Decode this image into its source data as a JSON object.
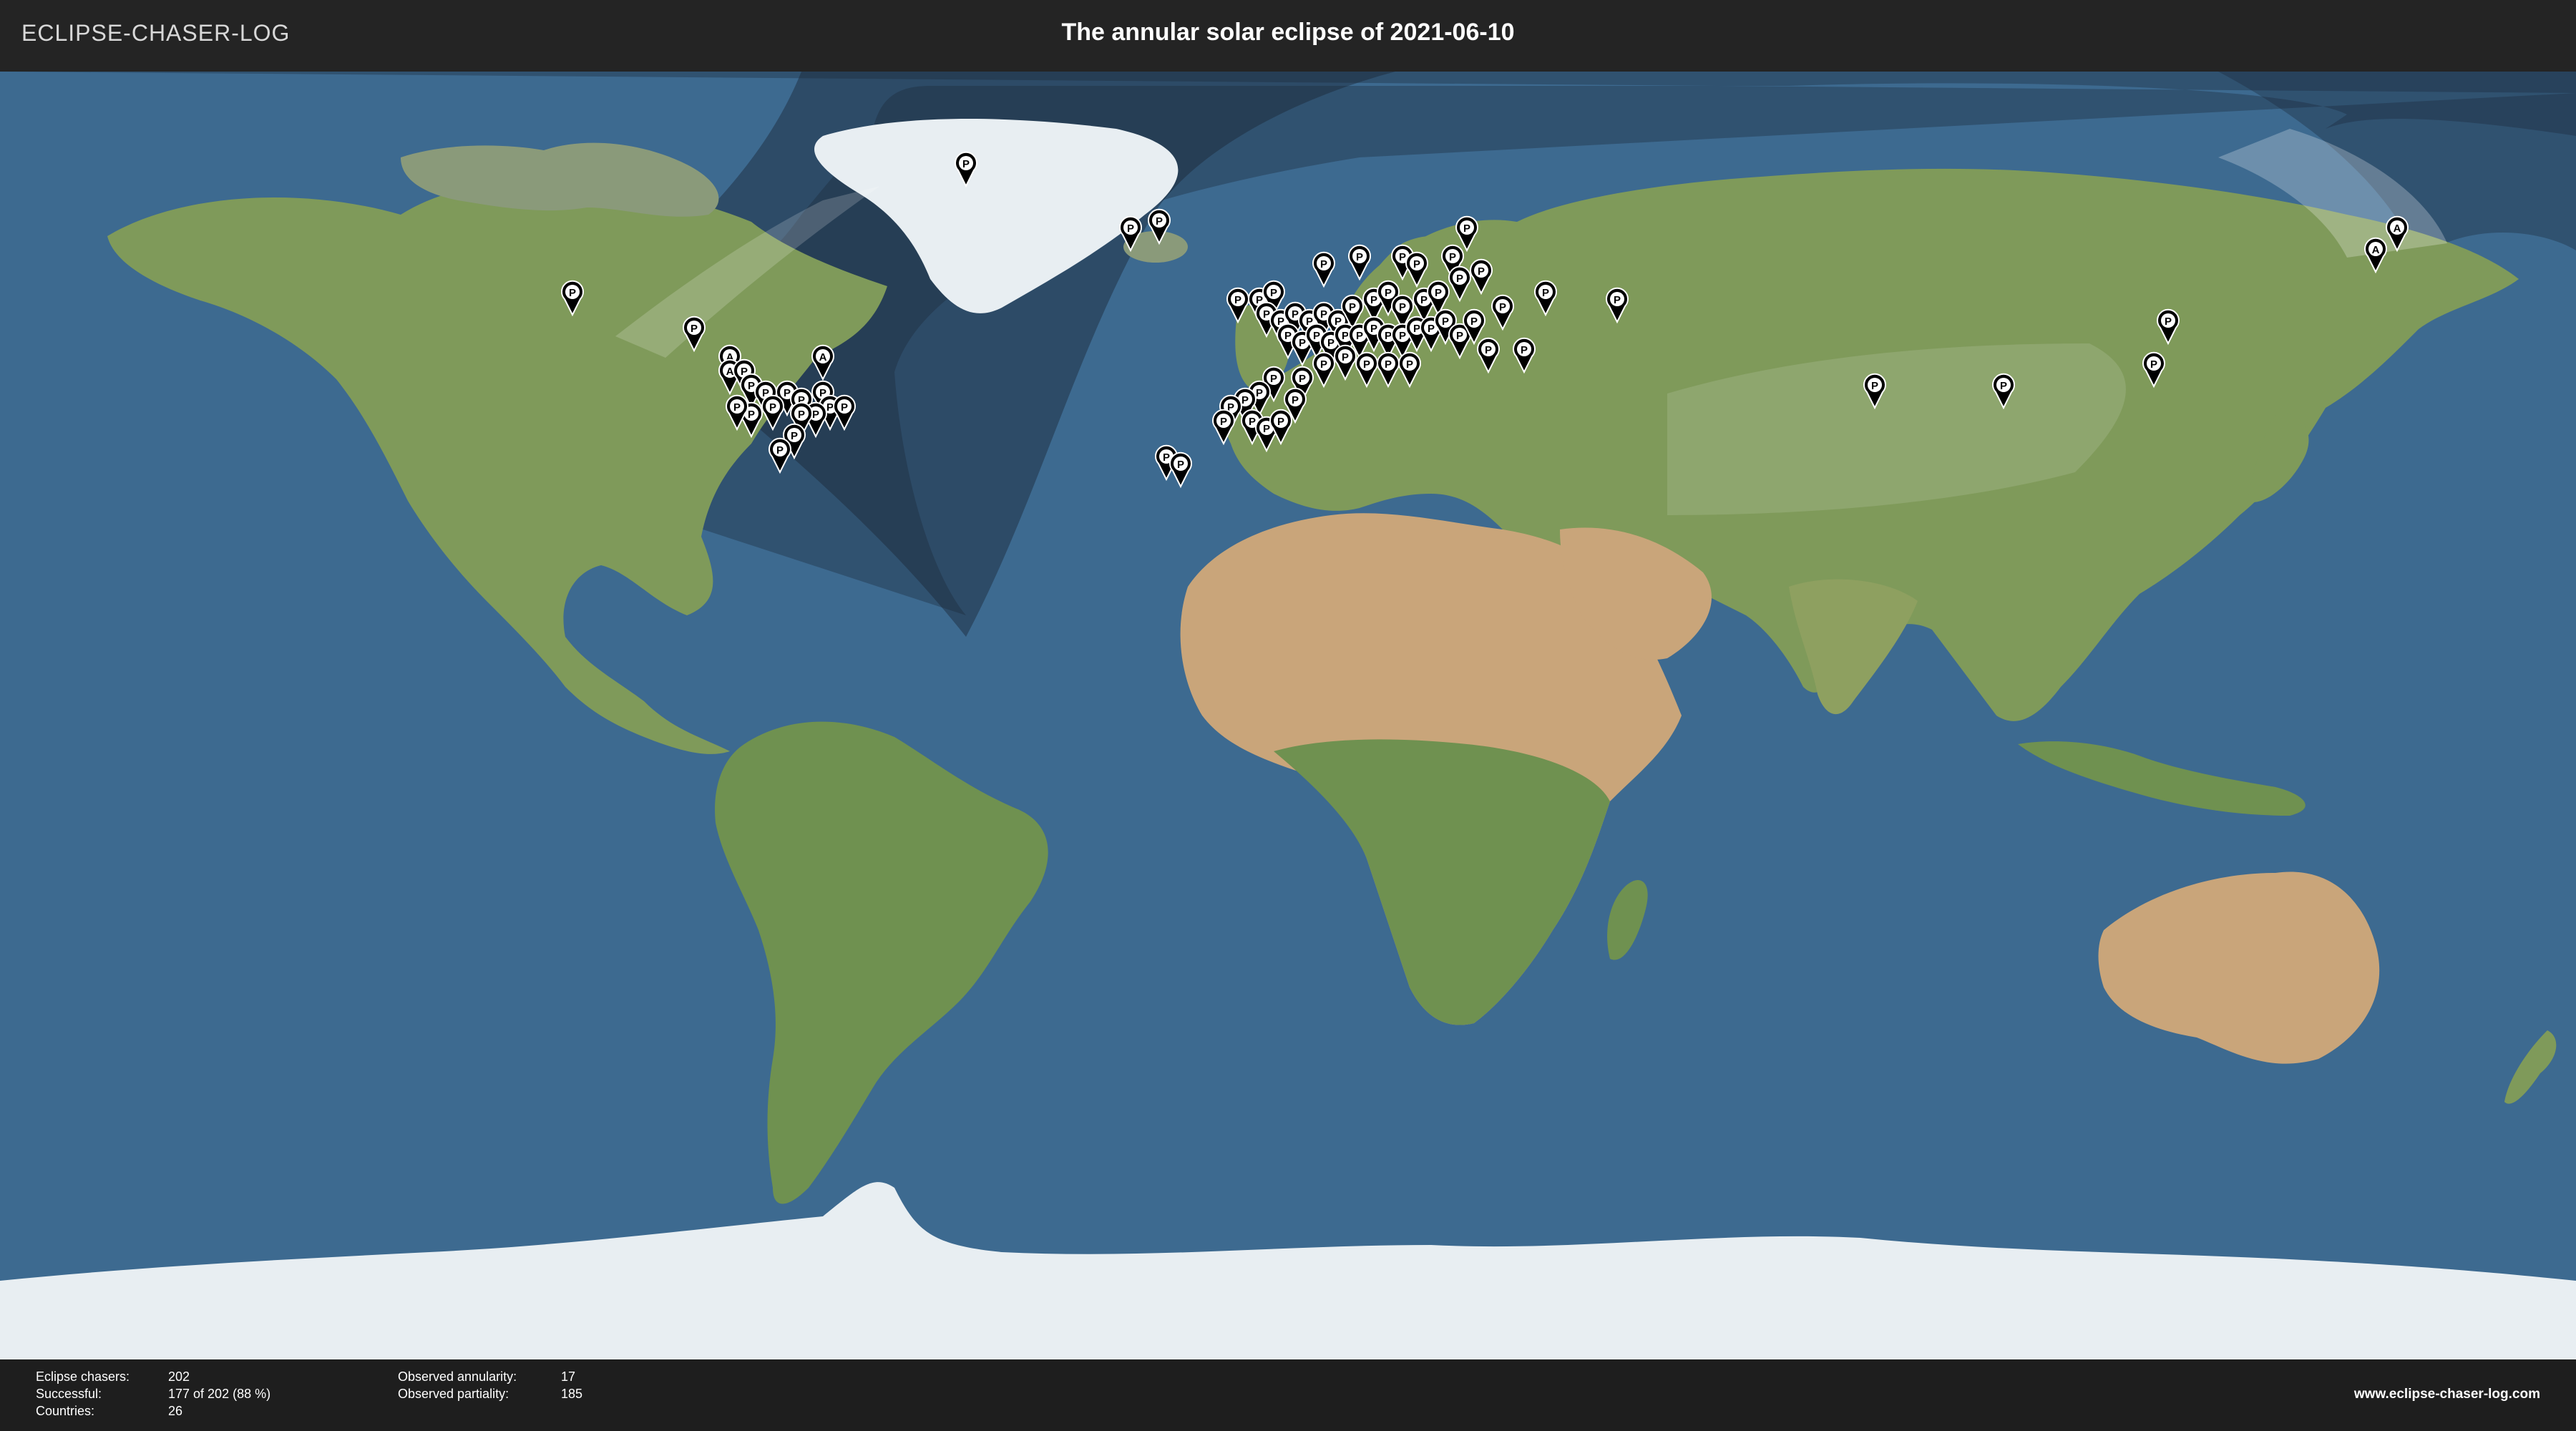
{
  "header": {
    "logo_text": "ECLIPSE-CHASER-LOG",
    "title": "The annular solar eclipse of 2021-06-10"
  },
  "map": {
    "ocean_color": "#3d6a90",
    "land_color": "#7f9a5a",
    "desert_color": "#c9a57a",
    "ice_color": "#e8eef2",
    "shadow_color": "#1a2636",
    "marker_color": "#000000",
    "marker_symbol_color": "#ffffff",
    "marker_icon": "map-pin-icon",
    "marker_types": {
      "P": "observed partiality",
      "A": "observed annularity"
    },
    "markers": [
      {
        "label": "P",
        "lon": -100,
        "lat": 56
      },
      {
        "label": "P",
        "lon": -83,
        "lat": 51
      },
      {
        "label": "A",
        "lon": -78,
        "lat": 47
      },
      {
        "label": "A",
        "lon": -65,
        "lat": 47
      },
      {
        "label": "A",
        "lon": -78,
        "lat": 45
      },
      {
        "label": "P",
        "lon": -76,
        "lat": 45
      },
      {
        "label": "P",
        "lon": -75,
        "lat": 43
      },
      {
        "label": "P",
        "lon": -73,
        "lat": 42
      },
      {
        "label": "P",
        "lon": -70,
        "lat": 42
      },
      {
        "label": "P",
        "lon": -68,
        "lat": 41
      },
      {
        "label": "P",
        "lon": -65,
        "lat": 42
      },
      {
        "label": "P",
        "lon": -64,
        "lat": 40
      },
      {
        "label": "P",
        "lon": -66,
        "lat": 39
      },
      {
        "label": "P",
        "lon": -62,
        "lat": 40
      },
      {
        "label": "P",
        "lon": -72,
        "lat": 40
      },
      {
        "label": "P",
        "lon": -75,
        "lat": 39
      },
      {
        "label": "P",
        "lon": -77,
        "lat": 40
      },
      {
        "label": "P",
        "lon": -68,
        "lat": 39
      },
      {
        "label": "P",
        "lon": -69,
        "lat": 36
      },
      {
        "label": "P",
        "lon": -71,
        "lat": 34
      },
      {
        "label": "P",
        "lon": -45,
        "lat": 74
      },
      {
        "label": "P",
        "lon": -22,
        "lat": 65
      },
      {
        "label": "P",
        "lon": -18,
        "lat": 66
      },
      {
        "label": "P",
        "lon": -17,
        "lat": 33
      },
      {
        "label": "P",
        "lon": -15,
        "lat": 32
      },
      {
        "label": "P",
        "lon": 5,
        "lat": 60
      },
      {
        "label": "P",
        "lon": 10,
        "lat": 61
      },
      {
        "label": "P",
        "lon": 16,
        "lat": 61
      },
      {
        "label": "P",
        "lon": 18,
        "lat": 60
      },
      {
        "label": "P",
        "lon": 23,
        "lat": 61
      },
      {
        "label": "P",
        "lon": 25,
        "lat": 65
      },
      {
        "label": "P",
        "lon": 27,
        "lat": 59
      },
      {
        "label": "P",
        "lon": -7,
        "lat": 55
      },
      {
        "label": "P",
        "lon": -4,
        "lat": 55
      },
      {
        "label": "P",
        "lon": -2,
        "lat": 56
      },
      {
        "label": "P",
        "lon": -3,
        "lat": 53
      },
      {
        "label": "P",
        "lon": -1,
        "lat": 52
      },
      {
        "label": "P",
        "lon": 1,
        "lat": 53
      },
      {
        "label": "P",
        "lon": 3,
        "lat": 52
      },
      {
        "label": "P",
        "lon": 5,
        "lat": 53
      },
      {
        "label": "P",
        "lon": 7,
        "lat": 52
      },
      {
        "label": "P",
        "lon": 9,
        "lat": 54
      },
      {
        "label": "P",
        "lon": 12,
        "lat": 55
      },
      {
        "label": "P",
        "lon": 14,
        "lat": 56
      },
      {
        "label": "P",
        "lon": 16,
        "lat": 54
      },
      {
        "label": "P",
        "lon": 19,
        "lat": 55
      },
      {
        "label": "P",
        "lon": 21,
        "lat": 56
      },
      {
        "label": "P",
        "lon": 24,
        "lat": 58
      },
      {
        "label": "P",
        "lon": 0,
        "lat": 50
      },
      {
        "label": "P",
        "lon": 2,
        "lat": 49
      },
      {
        "label": "P",
        "lon": 4,
        "lat": 50
      },
      {
        "label": "P",
        "lon": 6,
        "lat": 49
      },
      {
        "label": "P",
        "lon": 8,
        "lat": 50
      },
      {
        "label": "P",
        "lon": 10,
        "lat": 50
      },
      {
        "label": "P",
        "lon": 12,
        "lat": 51
      },
      {
        "label": "P",
        "lon": 14,
        "lat": 50
      },
      {
        "label": "P",
        "lon": 16,
        "lat": 50
      },
      {
        "label": "P",
        "lon": 18,
        "lat": 51
      },
      {
        "label": "P",
        "lon": 20,
        "lat": 51
      },
      {
        "label": "P",
        "lon": 22,
        "lat": 52
      },
      {
        "label": "P",
        "lon": 24,
        "lat": 50
      },
      {
        "label": "P",
        "lon": 26,
        "lat": 52
      },
      {
        "label": "P",
        "lon": 30,
        "lat": 54
      },
      {
        "label": "P",
        "lon": 36,
        "lat": 56
      },
      {
        "label": "P",
        "lon": 33,
        "lat": 48
      },
      {
        "label": "P",
        "lon": 28,
        "lat": 48
      },
      {
        "label": "P",
        "lon": 5,
        "lat": 46
      },
      {
        "label": "P",
        "lon": 8,
        "lat": 47
      },
      {
        "label": "P",
        "lon": 11,
        "lat": 46
      },
      {
        "label": "P",
        "lon": 14,
        "lat": 46
      },
      {
        "label": "P",
        "lon": 17,
        "lat": 46
      },
      {
        "label": "P",
        "lon": 2,
        "lat": 44
      },
      {
        "label": "P",
        "lon": -2,
        "lat": 44
      },
      {
        "label": "P",
        "lon": -4,
        "lat": 42
      },
      {
        "label": "P",
        "lon": -6,
        "lat": 41
      },
      {
        "label": "P",
        "lon": -8,
        "lat": 40
      },
      {
        "label": "P",
        "lon": -5,
        "lat": 38
      },
      {
        "label": "P",
        "lon": -3,
        "lat": 37
      },
      {
        "label": "P",
        "lon": -1,
        "lat": 38
      },
      {
        "label": "P",
        "lon": 1,
        "lat": 41
      },
      {
        "label": "P",
        "lon": -9,
        "lat": 38
      },
      {
        "label": "P",
        "lon": 46,
        "lat": 55
      },
      {
        "label": "P",
        "lon": 82,
        "lat": 43
      },
      {
        "label": "P",
        "lon": 100,
        "lat": 43
      },
      {
        "label": "P",
        "lon": 123,
        "lat": 52
      },
      {
        "label": "P",
        "lon": 121,
        "lat": 46
      },
      {
        "label": "A",
        "lon": 155,
        "lat": 65
      },
      {
        "label": "A",
        "lon": 152,
        "lat": 62
      }
    ]
  },
  "footer": {
    "stats_left": [
      {
        "key": "Eclipse chasers:",
        "value": "202"
      },
      {
        "key": "Successful:",
        "value": "177 of 202 (88 %)"
      },
      {
        "key": "Countries:",
        "value": "26"
      }
    ],
    "stats_right": [
      {
        "key": "Observed annularity:",
        "value": "17"
      },
      {
        "key": "Observed partiality:",
        "value": "185"
      }
    ],
    "website": "www.eclipse-chaser-log.com"
  }
}
